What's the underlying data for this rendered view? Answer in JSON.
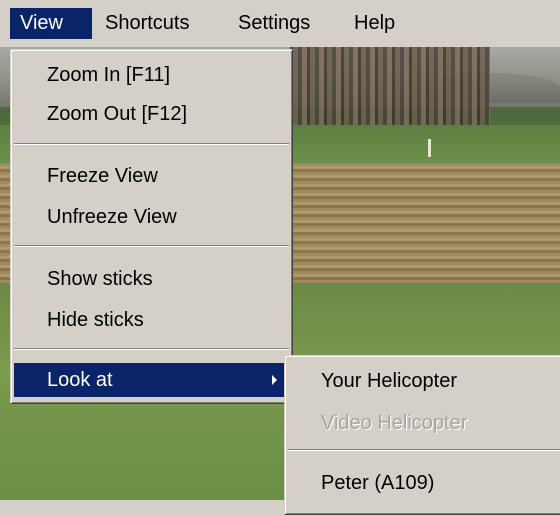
{
  "menubar": {
    "items": [
      {
        "label": "View"
      },
      {
        "label": "Shortcuts"
      },
      {
        "label": "Settings"
      },
      {
        "label": "Help"
      }
    ]
  },
  "view_menu": {
    "zoom_in": "Zoom In [F11]",
    "zoom_out": "Zoom Out [F12]",
    "freeze": "Freeze View",
    "unfreeze": "Unfreeze View",
    "show_sticks": "Show sticks",
    "hide_sticks": "Hide sticks",
    "look_at": "Look at"
  },
  "look_at_menu": {
    "your_helicopter": "Your Helicopter",
    "video_helicopter": "Video Helicopter",
    "peter": "Peter (A109)"
  },
  "colors": {
    "menu_face": "#d4d0c8",
    "highlight": "#0a246a",
    "disabled_text": "#a7a49c"
  }
}
